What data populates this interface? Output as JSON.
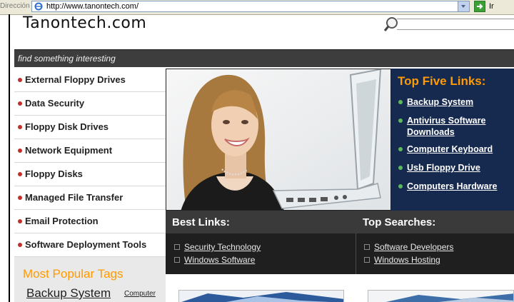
{
  "browser": {
    "address_label": "Dirección",
    "url": "http://www.tanontech.com/",
    "go_label": "Ir"
  },
  "site": {
    "title": "Tanontech.com",
    "tagline": "find something interesting"
  },
  "sidebar": {
    "items": [
      {
        "label": "External Floppy Drives"
      },
      {
        "label": "Data Security"
      },
      {
        "label": "Floppy Disk Drives"
      },
      {
        "label": "Network Equipment"
      },
      {
        "label": "Floppy Disks"
      },
      {
        "label": "Managed File Transfer"
      },
      {
        "label": "Email Protection"
      },
      {
        "label": "Software Deployment Tools"
      }
    ]
  },
  "tags": {
    "title": "Most Popular Tags",
    "items": [
      "Backup System",
      "Computer"
    ]
  },
  "top_five": {
    "title": "Top Five Links:",
    "items": [
      {
        "line1": "Backup System",
        "line2": ""
      },
      {
        "line1": "Antivirus Software",
        "line2": "Downloads"
      },
      {
        "line1": "Computer Keyboard",
        "line2": ""
      },
      {
        "line1": "Usb Floppy Drive",
        "line2": ""
      },
      {
        "line1": "Computers Hardware",
        "line2": ""
      }
    ]
  },
  "best_links": {
    "title": "Best Links:",
    "items": [
      "Security Technology",
      "Windows Software"
    ]
  },
  "top_searches": {
    "title": "Top Searches:",
    "items": [
      "Software Developers",
      "Windows Hosting"
    ]
  },
  "colors": {
    "accent_orange": "#ff9a00",
    "topfive_bg": "#16294e",
    "bullet_red": "#c0302a",
    "bullet_green": "#5cb85c"
  }
}
